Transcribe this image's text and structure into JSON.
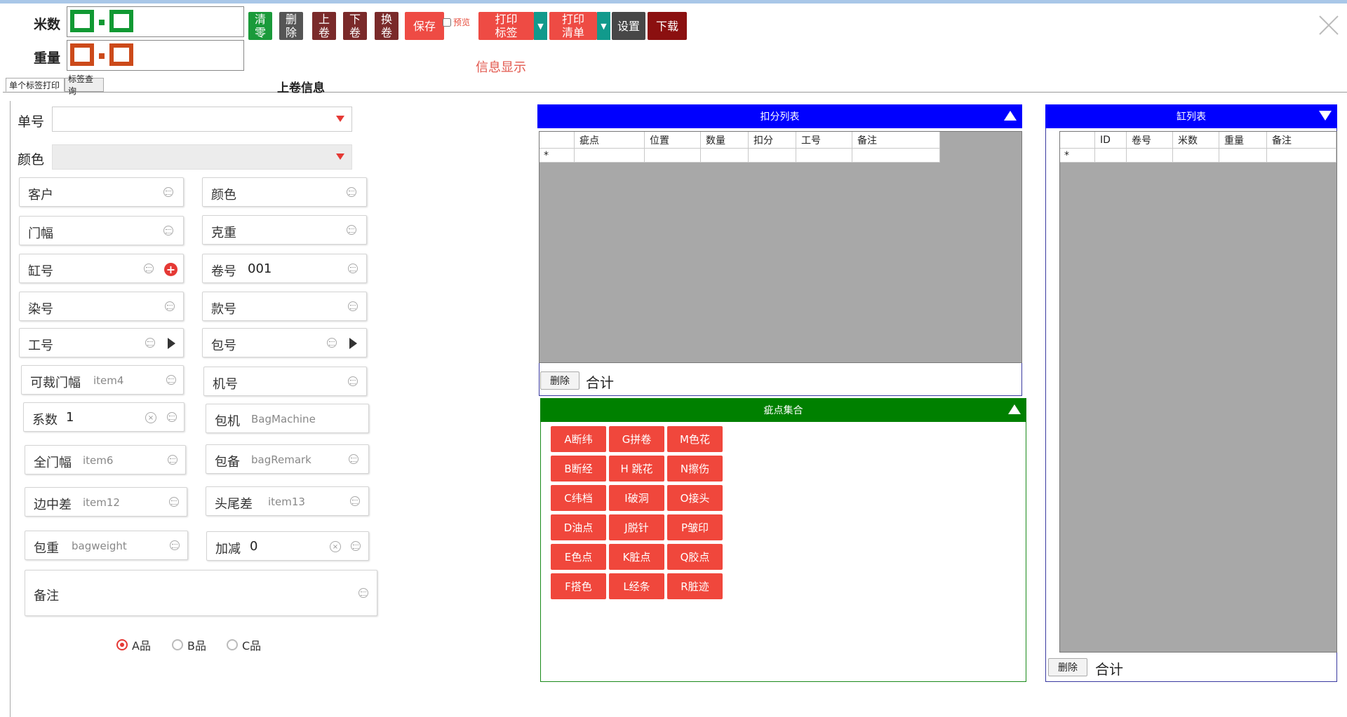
{
  "meters": {
    "length_label": "米数",
    "weight_label": "重量",
    "length_color": "#119933",
    "weight_color": "#cc4a1a"
  },
  "toolbar": {
    "clear": [
      "清",
      "零"
    ],
    "delete": [
      "删",
      "除"
    ],
    "up_roll": [
      "上",
      "卷"
    ],
    "down_roll": [
      "下",
      "卷"
    ],
    "change_roll": [
      "换",
      "卷"
    ],
    "save": "保存",
    "preview": "预览",
    "print_label": [
      "打印",
      "标签"
    ],
    "print_list": [
      "打印",
      "清单"
    ],
    "settings": "设置",
    "download": "下载"
  },
  "info_display": "信息显示",
  "tabs": {
    "single_print": "单个标签打印",
    "label_query": "标签查询"
  },
  "section_title": "上卷信息",
  "form": {
    "order_no_label": "单号",
    "color_label": "颜色",
    "fields": {
      "customer": {
        "label": "客户"
      },
      "color": {
        "label": "颜色"
      },
      "door_width": {
        "label": "门幅"
      },
      "gram_weight": {
        "label": "克重"
      },
      "vat_no": {
        "label": "缸号"
      },
      "roll_no": {
        "label": "卷号",
        "value": "001"
      },
      "dye_no": {
        "label": "染号"
      },
      "style_no": {
        "label": "款号"
      },
      "work_no": {
        "label": "工号"
      },
      "bag_no": {
        "label": "包号"
      },
      "cut_width": {
        "label": "可裁门幅",
        "placeholder": "item4"
      },
      "machine_no": {
        "label": "机号"
      },
      "coefficient": {
        "label": "系数",
        "value": "1"
      },
      "bag_machine": {
        "label": "包机",
        "placeholder": "BagMachine"
      },
      "full_width": {
        "label": "全门幅",
        "placeholder": "item6"
      },
      "bag_remark": {
        "label": "包备",
        "placeholder": "bagRemark"
      },
      "edge_diff": {
        "label": "边中差",
        "placeholder": "item12"
      },
      "head_tail_diff": {
        "label": "头尾差",
        "placeholder": "item13"
      },
      "bag_weight": {
        "label": "包重",
        "placeholder": "bagweight"
      },
      "add_sub": {
        "label": "加减",
        "value": "0"
      },
      "remark": {
        "label": "备注"
      }
    },
    "grades": [
      "A品",
      "B品",
      "C品"
    ],
    "selected_grade": "A品"
  },
  "deduction_list": {
    "title": "扣分列表",
    "header_color": "#0000ff",
    "columns": [
      "疵点",
      "位置",
      "数量",
      "扣分",
      "工号",
      "备注"
    ],
    "new_row_marker": "*",
    "delete_label": "删除",
    "total_label": "合计"
  },
  "defect_set": {
    "title": "疵点集合",
    "header_color": "#008000",
    "items": [
      "A断纬",
      "G拼卷",
      "M色花",
      "B断经",
      "H 跳花",
      "N擦伤",
      "C纬档",
      "I破洞",
      "O接头",
      "D油点",
      "J脱针",
      "P皱印",
      "E色点",
      "K脏点",
      "Q胶点",
      "F搭色",
      "L经条",
      "R脏迹"
    ]
  },
  "vat_list": {
    "title": "缸列表",
    "header_color": "#0000ff",
    "columns": [
      "ID",
      "卷号",
      "米数",
      "重量",
      "备注"
    ],
    "new_row_marker": "*",
    "delete_label": "删除",
    "total_label": "合计"
  }
}
